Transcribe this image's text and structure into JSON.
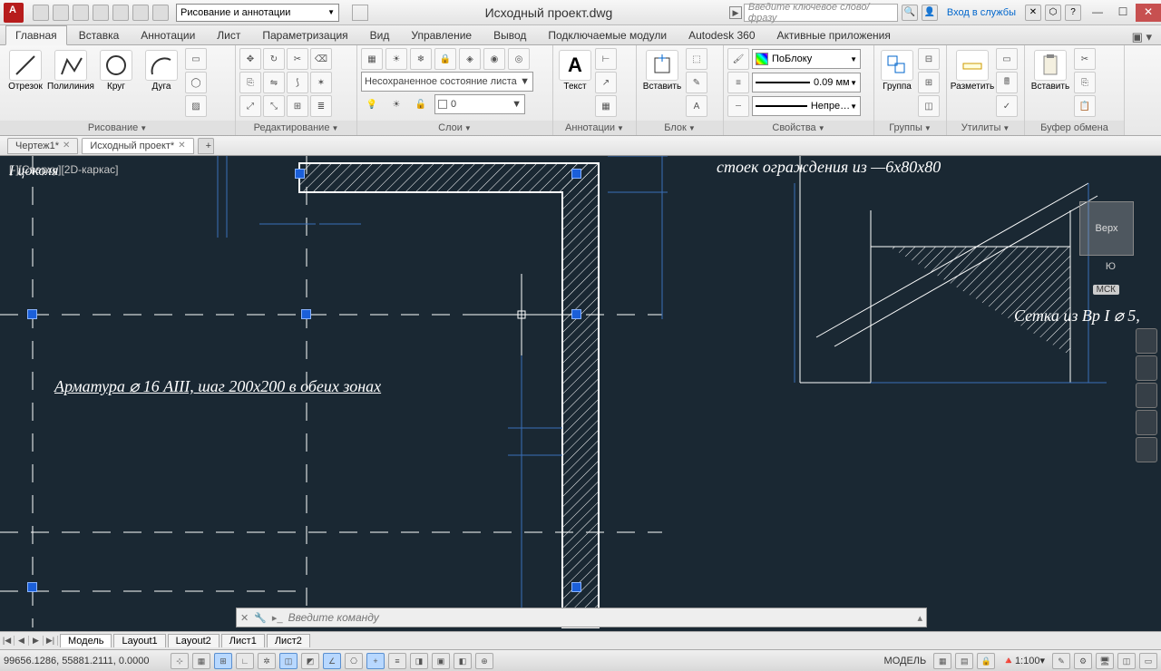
{
  "titlebar": {
    "workspace": "Рисование и аннотации",
    "title": "Исходный проект.dwg",
    "search_placeholder": "Введите ключевое слово/фразу",
    "signin": "Вход в службы"
  },
  "ribbon_tabs": [
    "Главная",
    "Вставка",
    "Аннотации",
    "Лист",
    "Параметризация",
    "Вид",
    "Управление",
    "Вывод",
    "Подключаемые модули",
    "Autodesk 360",
    "Активные приложения"
  ],
  "ribbon_active_tab": 0,
  "panels": {
    "draw": {
      "title": "Рисование",
      "items": [
        "Отрезок",
        "Полилиния",
        "Круг",
        "Дуга"
      ]
    },
    "modify": {
      "title": "Редактирование"
    },
    "layers": {
      "title": "Слои",
      "state": "Несохраненное состояние листа",
      "current": "0"
    },
    "annot": {
      "title": "Аннотации",
      "text_btn": "Текст"
    },
    "block": {
      "title": "Блок",
      "insert": "Вставить"
    },
    "props": {
      "title": "Свойства",
      "color": "ПоБлоку",
      "lw": "0.09 мм",
      "lt": "Непре…"
    },
    "groups": {
      "title": "Группы",
      "btn": "Группа"
    },
    "utils": {
      "title": "Утилиты",
      "btn": "Разметить"
    },
    "clip": {
      "title": "Буфер обмена",
      "btn": "Вставить"
    }
  },
  "doctabs": [
    {
      "label": "Чертеж1*",
      "active": false
    },
    {
      "label": "Исходный проект*",
      "active": true
    }
  ],
  "canvas": {
    "view_label": "[-][Сверху][2D-каркас]",
    "text_tsokol": "I цоколя",
    "text_arm": "Арматура ⌀ 16 AIII, шаг 200х200 в обеих зонах",
    "text_stoek": "стоек ограждения из —6х80х80",
    "text_setka": "Сетка из Вр I ⌀ 5,",
    "viewcube": "Верх",
    "viewcube_south": "Ю",
    "viewcube_wcs": "МСК",
    "cmd_placeholder": "Введите команду"
  },
  "layout_tabs": [
    "Модель",
    "Layout1",
    "Layout2",
    "Лист1",
    "Лист2"
  ],
  "layout_active": 0,
  "status": {
    "coords": "99656.1286, 55881.2111, 0.0000",
    "space": "МОДЕЛЬ",
    "scale": "1:100"
  }
}
